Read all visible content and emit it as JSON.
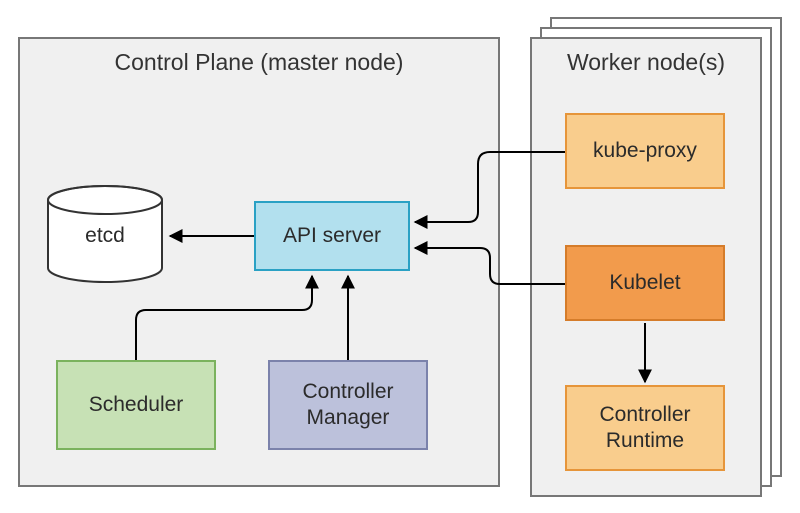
{
  "controlPlane": {
    "title": "Control Plane (master node)",
    "etcd": "etcd",
    "apiServer": "API server",
    "scheduler": "Scheduler",
    "controllerManager": "Controller\nManager"
  },
  "workerNode": {
    "title": "Worker node(s)",
    "kubeProxy": "kube-proxy",
    "kubelet": "Kubelet",
    "controllerRuntime": "Controller\nRuntime"
  },
  "colors": {
    "apiServer": {
      "bg": "#b2e0ee",
      "border": "#2aa1c4"
    },
    "scheduler": {
      "bg": "#c7e1b5",
      "border": "#7bb25e"
    },
    "ctrlMgr": {
      "bg": "#bcc1db",
      "border": "#7b82ab"
    },
    "kubeProxy": {
      "bg": "#f9cd8d",
      "border": "#e6953a"
    },
    "kubelet": {
      "bg": "#f29b4c",
      "border": "#d57c2a"
    },
    "ctrlRuntime": {
      "bg": "#f9cd8d",
      "border": "#e6953a"
    }
  }
}
